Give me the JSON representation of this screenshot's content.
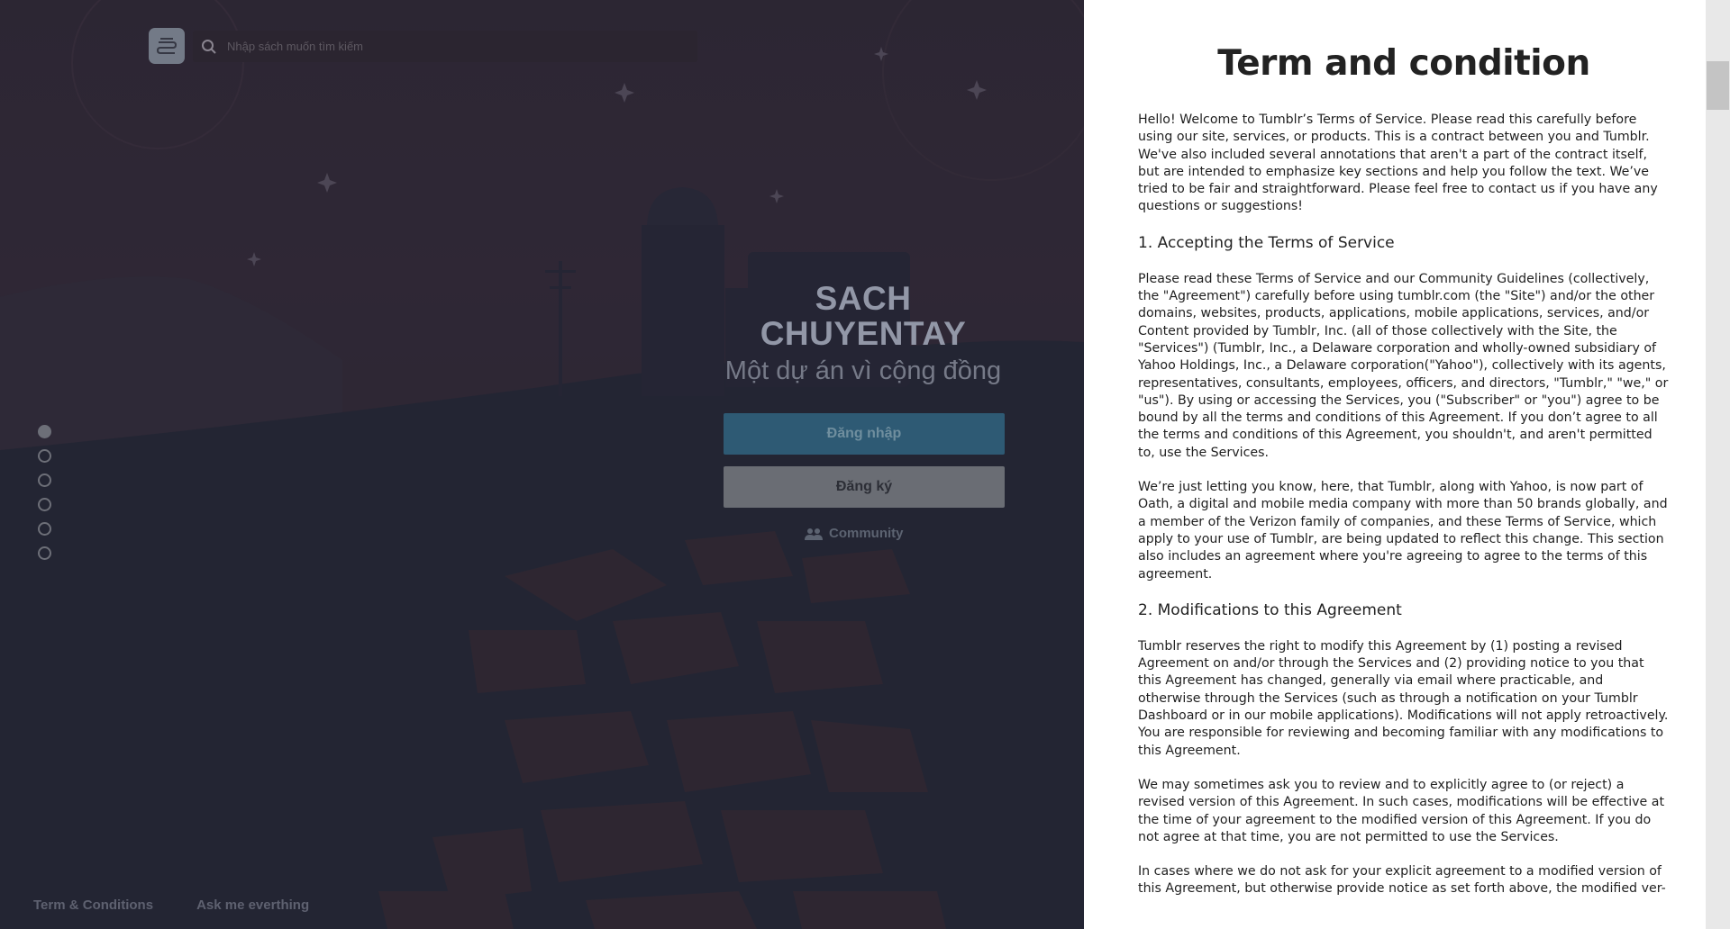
{
  "search": {
    "placeholder": "Nhập sách muốn tìm kiếm"
  },
  "hero": {
    "brand_line1": "SACH",
    "brand_line2": "CHUYENTAY",
    "tagline": "Một dự án vì cộng đồng",
    "login_label": "Đăng nhập",
    "register_label": "Đăng ký",
    "community_label": "Community"
  },
  "slider": {
    "count": 6,
    "active_index": 0
  },
  "footer": {
    "terms_link": "Term & Conditions",
    "ask_link": "Ask me everthing"
  },
  "terms": {
    "title": "Term and condition",
    "intro": "Hello! Welcome to Tumblr’s Terms of Service. Please read this carefully before using our site, services, or products. This is a contract between you and Tumblr. We've also included several annotations that aren't a part of the contract itself, but are intended to emphasize key sections and help you follow the text. We’ve tried to be fair and straightforward. Please feel free to contact us if you have any questions or suggestions!",
    "section1_heading": "1. Accepting the Terms of Service",
    "section1_p1": "Please read these Terms of Service and our Community Guidelines (collectively, the \"Agreement\") carefully before using tumblr.com (the \"Site\") and/or the other domains, websites, products, applications, mobile applications, services, and/or Content provided by Tumblr, Inc. (all of those collectively with the Site, the \"Services\") (Tumblr, Inc., a Delaware corporation and wholly-owned subsidiary of Yahoo Holdings, Inc., a Delaware corporation(\"Yahoo\"), collectively with its agents, representatives, consultants, employees, officers, and directors, \"Tumblr,\" \"we,\" or \"us\"). By using or accessing the Services, you (\"Subscriber\" or \"you\") agree to be bound by all the terms and conditions of this Agreement. If you don’t agree to all the terms and conditions of this Agreement, you shouldn't, and aren't permitted to, use the Services.",
    "section1_p2": "We’re just letting you know, here, that Tumblr, along with Yahoo, is now part of Oath, a digital and mobile media company with more than 50 brands globally, and a member of the Verizon family of companies, and these Terms of Service, which apply to your use of Tumblr, are being updated to reflect this change. This section also includes an agreement where you're agreeing to agree to the terms of this agreement.",
    "section2_heading": "2. Modifications to this Agreement",
    "section2_p1": "Tumblr reserves the right to modify this Agreement by (1) posting a revised Agreement on and/or through the Services and (2) providing notice to you that this Agreement has changed, generally via email where practicable, and otherwise through the Services (such as through a notification on your Tumblr Dashboard or in our mobile applications). Modifications will not apply retroactively. You are responsible for reviewing and becoming familiar with any modifications to this Agreement.",
    "section2_p2": "We may sometimes ask you to review and to explicitly agree to (or reject) a revised version of this Agreement. In such cases, modifications will be effective at the time of your agreement to the modified version of this Agreement. If you do not agree at that time, you are not permitted to use the Services.",
    "section2_p3": "In cases where we do not ask for your explicit agreement to a modified version of this Agreement, but otherwise provide notice as set forth above, the modified ver-"
  }
}
